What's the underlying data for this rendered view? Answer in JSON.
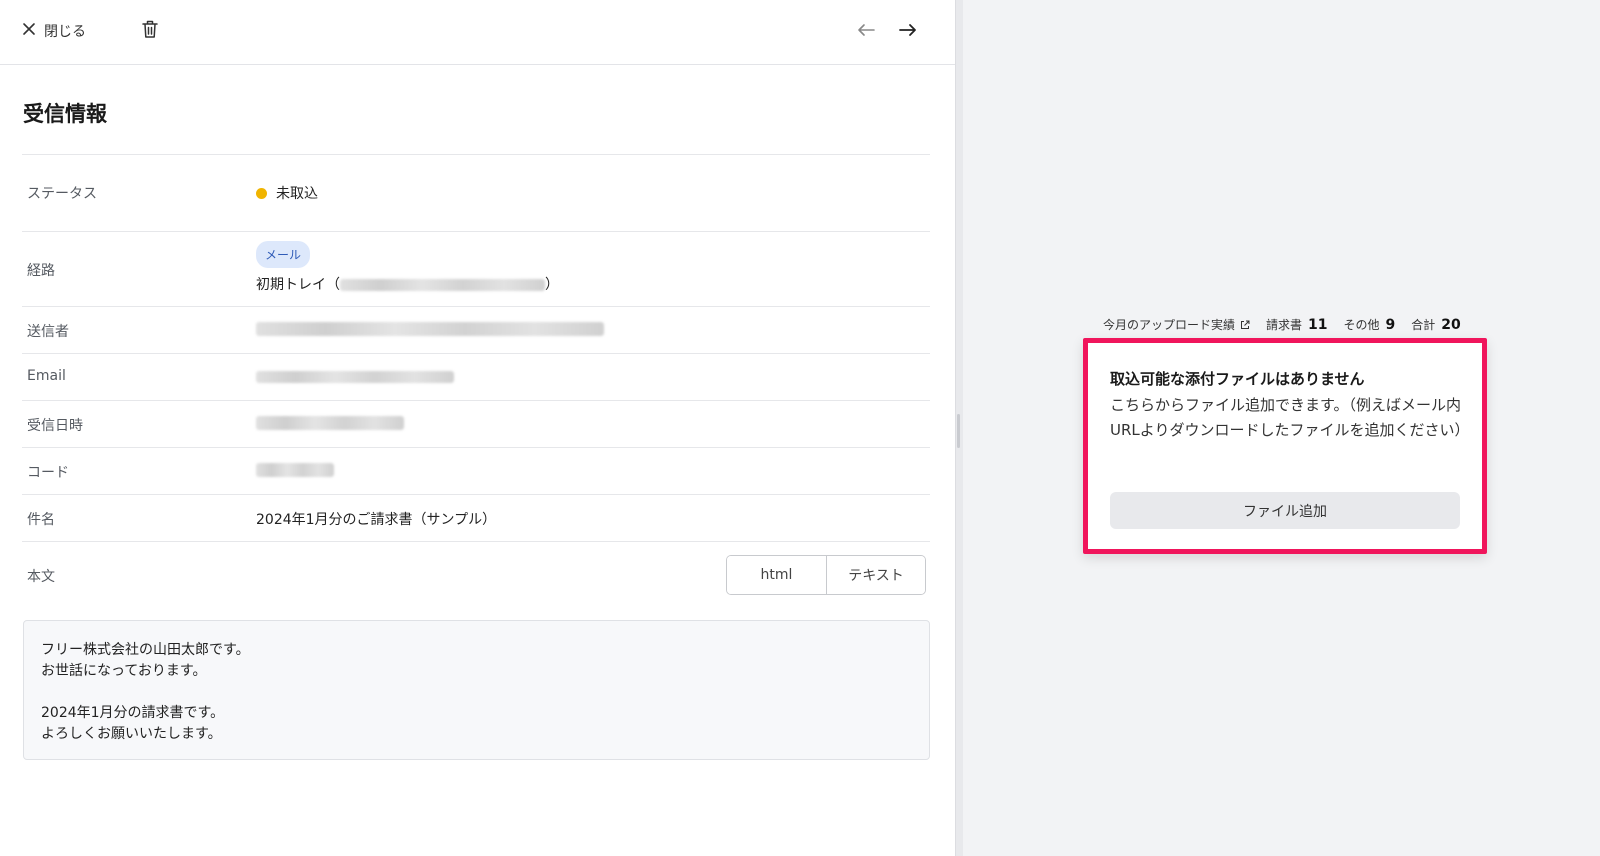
{
  "toolbar": {
    "close_label": "閉じる"
  },
  "section": {
    "title": "受信情報"
  },
  "fields": {
    "status": {
      "label": "ステータス",
      "value": "未取込",
      "color": "#f0b400"
    },
    "route": {
      "label": "経路",
      "tag": "メール",
      "tray_prefix": "初期トレイ（",
      "tray_suffix": "）"
    },
    "sender": {
      "label": "送信者"
    },
    "email": {
      "label": "Email"
    },
    "received_at": {
      "label": "受信日時"
    },
    "code": {
      "label": "コード"
    },
    "subject": {
      "label": "件名",
      "value": "2024年1月分のご請求書（サンプル）"
    },
    "body": {
      "label": "本文"
    }
  },
  "body_toggle": {
    "html_label": "html",
    "text_label": "テキスト"
  },
  "body_text": [
    "フリー株式会社の山田太郎です。",
    "お世話になっております。",
    "",
    "2024年1月分の請求書です。",
    "よろしくお願いいたします。"
  ],
  "upload_stats": {
    "link_label": "今月のアップロード実績",
    "invoice_label": "請求書",
    "invoice_count": "11",
    "other_label": "その他",
    "other_count": "9",
    "total_label": "合計",
    "total_count": "20"
  },
  "attachment_card": {
    "title": "取込可能な添付ファイルはありません",
    "description": "こちらからファイル追加できます。（例えばメール内URLよりダウンロードしたファイルを追加ください）",
    "button_label": "ファイル追加",
    "highlight_color": "#f0155c"
  }
}
